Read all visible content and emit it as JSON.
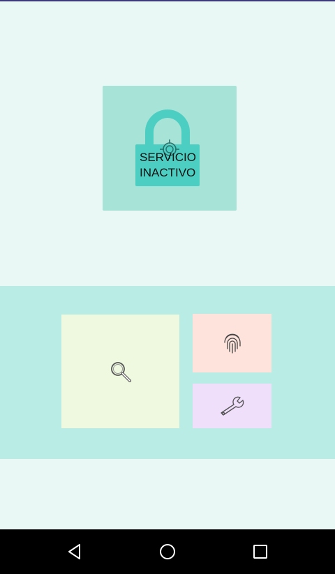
{
  "service_status": {
    "text": "SERVICIO\nINACTIVO",
    "icon": "lock-icon",
    "overlay_icon": "target-icon",
    "color_tile": "#a8e3d8",
    "color_lock": "#4ccfc2"
  },
  "actions": [
    {
      "name": "search",
      "icon": "search-icon",
      "color": "#eef9df"
    },
    {
      "name": "fingerprint",
      "icon": "fingerprint-icon",
      "color": "#fde3dc"
    },
    {
      "name": "settings",
      "icon": "wrench-icon",
      "color": "#efdffb"
    }
  ],
  "navbar": {
    "buttons": [
      "back-icon",
      "home-icon",
      "recents-icon"
    ]
  }
}
